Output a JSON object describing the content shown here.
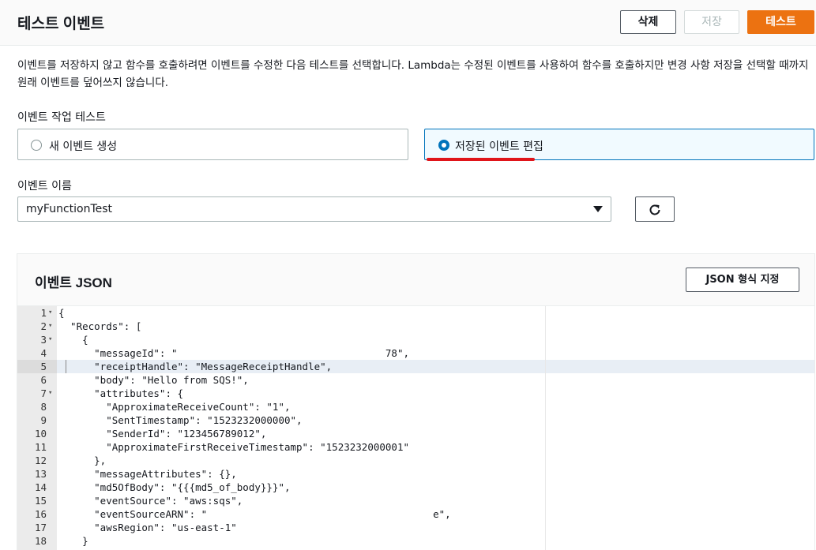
{
  "header": {
    "title": "테스트 이벤트",
    "delete_label": "삭제",
    "save_label": "저장",
    "test_label": "테스트"
  },
  "description": "이벤트를 저장하지 않고 함수를 호출하려면 이벤트를 수정한 다음 테스트를 선택합니다. Lambda는 수정된 이벤트를 사용하여 함수를 호출하지만 변경 사항 저장을 선택할 때까지 원래 이벤트를 덮어쓰지 않습니다.",
  "event_action": {
    "label": "이벤트 작업 테스트",
    "options": [
      {
        "label": "새 이벤트 생성",
        "selected": false
      },
      {
        "label": "저장된 이벤트 편집",
        "selected": true
      }
    ]
  },
  "event_name": {
    "label": "이벤트 이름",
    "value": "myFunctionTest"
  },
  "json_panel": {
    "title": "이벤트 JSON",
    "format_button": "JSON 형식 지정",
    "active_line": 5,
    "lines": [
      {
        "n": "1",
        "fold": true,
        "text": "{"
      },
      {
        "n": "2",
        "fold": true,
        "text": "  \"Records\": ["
      },
      {
        "n": "3",
        "fold": true,
        "text": "    {"
      },
      {
        "n": "4",
        "fold": false,
        "text": "      \"messageId\": \"                                   78\","
      },
      {
        "n": "5",
        "fold": false,
        "text": "      \"receiptHandle\": \"MessageReceiptHandle\","
      },
      {
        "n": "6",
        "fold": false,
        "text": "      \"body\": \"Hello from SQS!\","
      },
      {
        "n": "7",
        "fold": true,
        "text": "      \"attributes\": {"
      },
      {
        "n": "8",
        "fold": false,
        "text": "        \"ApproximateReceiveCount\": \"1\","
      },
      {
        "n": "9",
        "fold": false,
        "text": "        \"SentTimestamp\": \"1523232000000\","
      },
      {
        "n": "10",
        "fold": false,
        "text": "        \"SenderId\": \"123456789012\","
      },
      {
        "n": "11",
        "fold": false,
        "text": "        \"ApproximateFirstReceiveTimestamp\": \"1523232000001\""
      },
      {
        "n": "12",
        "fold": false,
        "text": "      },"
      },
      {
        "n": "13",
        "fold": false,
        "text": "      \"messageAttributes\": {},"
      },
      {
        "n": "14",
        "fold": false,
        "text": "      \"md5OfBody\": \"{{{md5_of_body}}}\","
      },
      {
        "n": "15",
        "fold": false,
        "text": "      \"eventSource\": \"aws:sqs\","
      },
      {
        "n": "16",
        "fold": false,
        "text": "      \"eventSourceARN\": \"                                      e\","
      },
      {
        "n": "17",
        "fold": false,
        "text": "      \"awsRegion\": \"us-east-1\""
      },
      {
        "n": "18",
        "fold": false,
        "text": "    }"
      }
    ]
  },
  "colors": {
    "accent": "#ec7211",
    "selected_border": "#0073bb",
    "annotation": "#e0151a"
  },
  "icons": {
    "refresh": "refresh-icon",
    "dropdown": "caret-down-icon"
  }
}
